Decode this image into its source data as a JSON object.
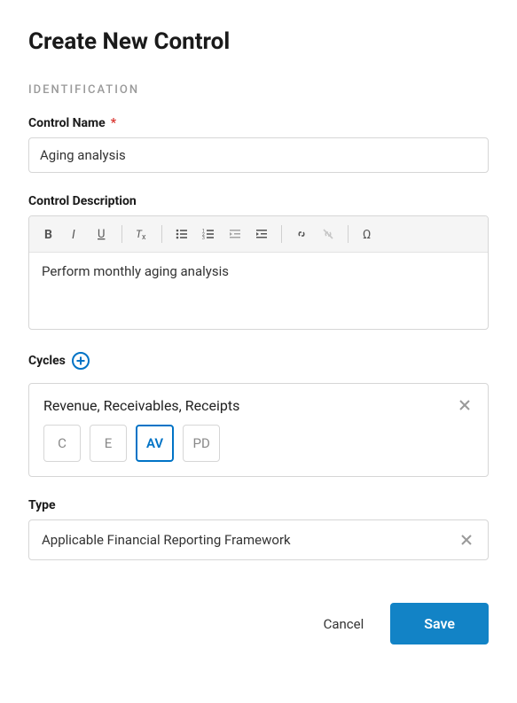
{
  "title": "Create New Control",
  "section": "IDENTIFICATION",
  "fields": {
    "control_name": {
      "label": "Control Name",
      "required": "*",
      "value": "Aging analysis"
    },
    "control_description": {
      "label": "Control Description",
      "value": "Perform monthly aging analysis"
    },
    "cycles": {
      "label": "Cycles",
      "entry_title": "Revenue, Receivables, Receipts",
      "options": [
        "C",
        "E",
        "AV",
        "PD"
      ],
      "selected_index": 2
    },
    "type": {
      "label": "Type",
      "value": "Applicable Financial Reporting Framework"
    }
  },
  "buttons": {
    "cancel": "Cancel",
    "save": "Save"
  }
}
